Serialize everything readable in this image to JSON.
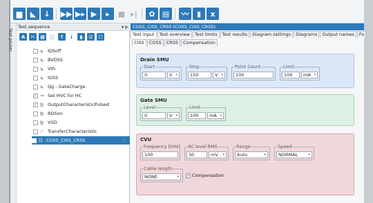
{
  "left_panel": {
    "vertical_tab": "Test picker",
    "header": "Test sequence",
    "pin": "▾ ᵽ",
    "tool_icons": [
      "A",
      "✂",
      "▦",
      "▢",
      "↑",
      "↓",
      "▮",
      "☑",
      "☐"
    ],
    "items": [
      {
        "label": "IDSoff",
        "checked": false,
        "icon": "chart-icon"
      },
      {
        "label": "BVDSS",
        "checked": false,
        "icon": "chart-icon"
      },
      {
        "label": "Vth",
        "checked": false,
        "icon": "chart-icon"
      },
      {
        "label": "IGSS",
        "checked": false,
        "icon": "chart-icon"
      },
      {
        "label": "Qg - GateCharge",
        "checked": false,
        "icon": "chart-icon"
      },
      {
        "label": "Set HVC for HC",
        "checked": true,
        "icon": "setting-icon"
      },
      {
        "label": "OutputCharacteristicPulsed",
        "checked": true,
        "icon": "pulse-icon"
      },
      {
        "label": "RDSon",
        "checked": false,
        "icon": "pulse-icon"
      },
      {
        "label": "VSD",
        "checked": false,
        "icon": "pulse-icon"
      },
      {
        "label": "TransferCharacteristic",
        "checked": false,
        "icon": "line-icon"
      },
      {
        "label": "COSS_CISS_CRSS",
        "checked": false,
        "icon": "cv-icon",
        "selected": true
      }
    ]
  },
  "right_panel": {
    "title": "COSS_CISS_CRSS (COSS_CISS_CRSS)",
    "tabs": [
      "Test input",
      "Test overview",
      "Test limits",
      "Test results",
      "Diagram settings",
      "Diagrams",
      "Output names",
      "Fo"
    ],
    "subtabs": [
      "CISS",
      "COSS",
      "CRSS",
      "Compensation"
    ],
    "drain_smu": {
      "title": "Drain SMU",
      "start_label": "Start",
      "start_value": "0",
      "start_unit": "V",
      "stop_label": "Stop",
      "stop_value": "150",
      "stop_unit": "V",
      "points_label": "Point Count",
      "points_value": "100",
      "limit_label": "Limit",
      "limit_value": "100",
      "limit_unit": "mA"
    },
    "gate_smu": {
      "title": "Gate SMU",
      "level_label": "Level",
      "level_value": "0",
      "level_unit": "V",
      "limit_label": "Limit",
      "limit_value": "100",
      "limit_unit": "mA"
    },
    "cvu": {
      "title": "CVU",
      "freq_label": "Frequency [kHz]",
      "freq_value": "100",
      "ac_label": "AC level RMS",
      "ac_value": "30",
      "ac_unit": "mV",
      "range_label": "Range",
      "range_value": "Auto",
      "speed_label": "Speed",
      "speed_value": "NORMAL",
      "cable_label": "Cable length",
      "cable_value": "NONE",
      "comp_label": "Compensation",
      "comp_checked": true
    }
  }
}
